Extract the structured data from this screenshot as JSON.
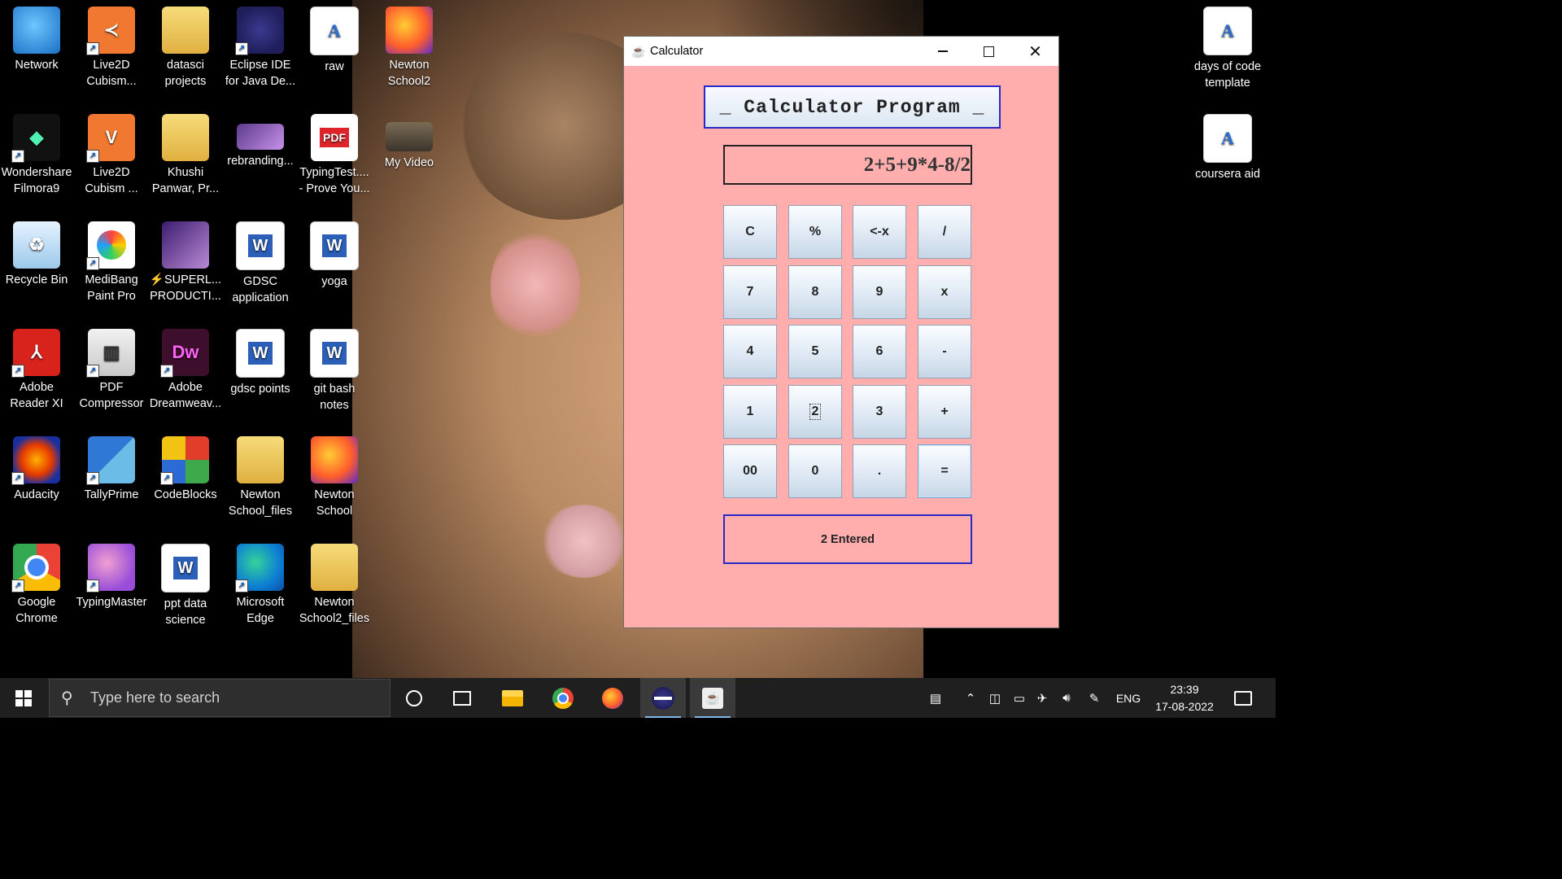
{
  "desktop": {
    "icons": [
      {
        "label": "Network",
        "icon": "network-icon"
      },
      {
        "label": "Live2D Cubism...",
        "icon": "live2d-icon"
      },
      {
        "label": "datasci projects",
        "icon": "folder-icon"
      },
      {
        "label": "Eclipse IDE for Java De...",
        "icon": "eclipse-icon"
      },
      {
        "label": "raw",
        "icon": "document-icon"
      },
      {
        "label": "Newton School2",
        "icon": "firefox-icon"
      },
      {
        "label": "Wondershare Filmora9",
        "icon": "filmora-icon"
      },
      {
        "label": "Live2D Cubism ...",
        "icon": "live2d-icon"
      },
      {
        "label": "Khushi Panwar, Pr...",
        "icon": "folder-icon"
      },
      {
        "label": "rebranding...",
        "icon": "image-icon"
      },
      {
        "label": "TypingTest.... - Prove You...",
        "icon": "pdf-icon"
      },
      {
        "label": "My Video",
        "icon": "video-icon"
      },
      {
        "label": "Recycle Bin",
        "icon": "recycle-bin-icon"
      },
      {
        "label": "MediBang Paint Pro",
        "icon": "medibang-icon"
      },
      {
        "label": "⚡SUPERL... PRODUCTI...",
        "icon": "image-icon"
      },
      {
        "label": "GDSC application",
        "icon": "word-icon"
      },
      {
        "label": "yoga",
        "icon": "word-icon"
      },
      {
        "label": "Adobe Reader XI",
        "icon": "adobe-reader-icon"
      },
      {
        "label": "PDF Compressor",
        "icon": "zip-icon"
      },
      {
        "label": "Adobe Dreamweav...",
        "icon": "dreamweaver-icon"
      },
      {
        "label": "gdsc points",
        "icon": "word-icon"
      },
      {
        "label": "git bash notes",
        "icon": "word-icon"
      },
      {
        "label": "Audacity",
        "icon": "audacity-icon"
      },
      {
        "label": "TallyPrime",
        "icon": "tally-icon"
      },
      {
        "label": "CodeBlocks",
        "icon": "codeblocks-icon"
      },
      {
        "label": "Newton School_files",
        "icon": "folder-icon"
      },
      {
        "label": "Newton School",
        "icon": "firefox-icon"
      },
      {
        "label": "Google Chrome",
        "icon": "chrome-icon"
      },
      {
        "label": "TypingMaster",
        "icon": "typingmaster-icon"
      },
      {
        "label": "ppt data science",
        "icon": "word-icon"
      },
      {
        "label": "Microsoft Edge",
        "icon": "edge-icon"
      },
      {
        "label": "Newton School2_files",
        "icon": "folder-icon"
      },
      {
        "label": "days of code template",
        "icon": "document-icon"
      },
      {
        "label": "coursera aid",
        "icon": "document-icon"
      }
    ]
  },
  "calculator": {
    "window_title": "Calculator",
    "heading": "_ Calculator Program _",
    "display": "2+5+9*4-8/2",
    "keys": [
      [
        "C",
        "%",
        "<-x",
        "/"
      ],
      [
        "7",
        "8",
        "9",
        "x"
      ],
      [
        "4",
        "5",
        "6",
        "-"
      ],
      [
        "1",
        "2",
        "3",
        "+"
      ],
      [
        "00",
        "0",
        ".",
        "="
      ]
    ],
    "status": "2 Entered"
  },
  "taskbar": {
    "search_placeholder": "Type here to search",
    "language": "ENG",
    "time": "23:39",
    "date": "17-08-2022"
  }
}
